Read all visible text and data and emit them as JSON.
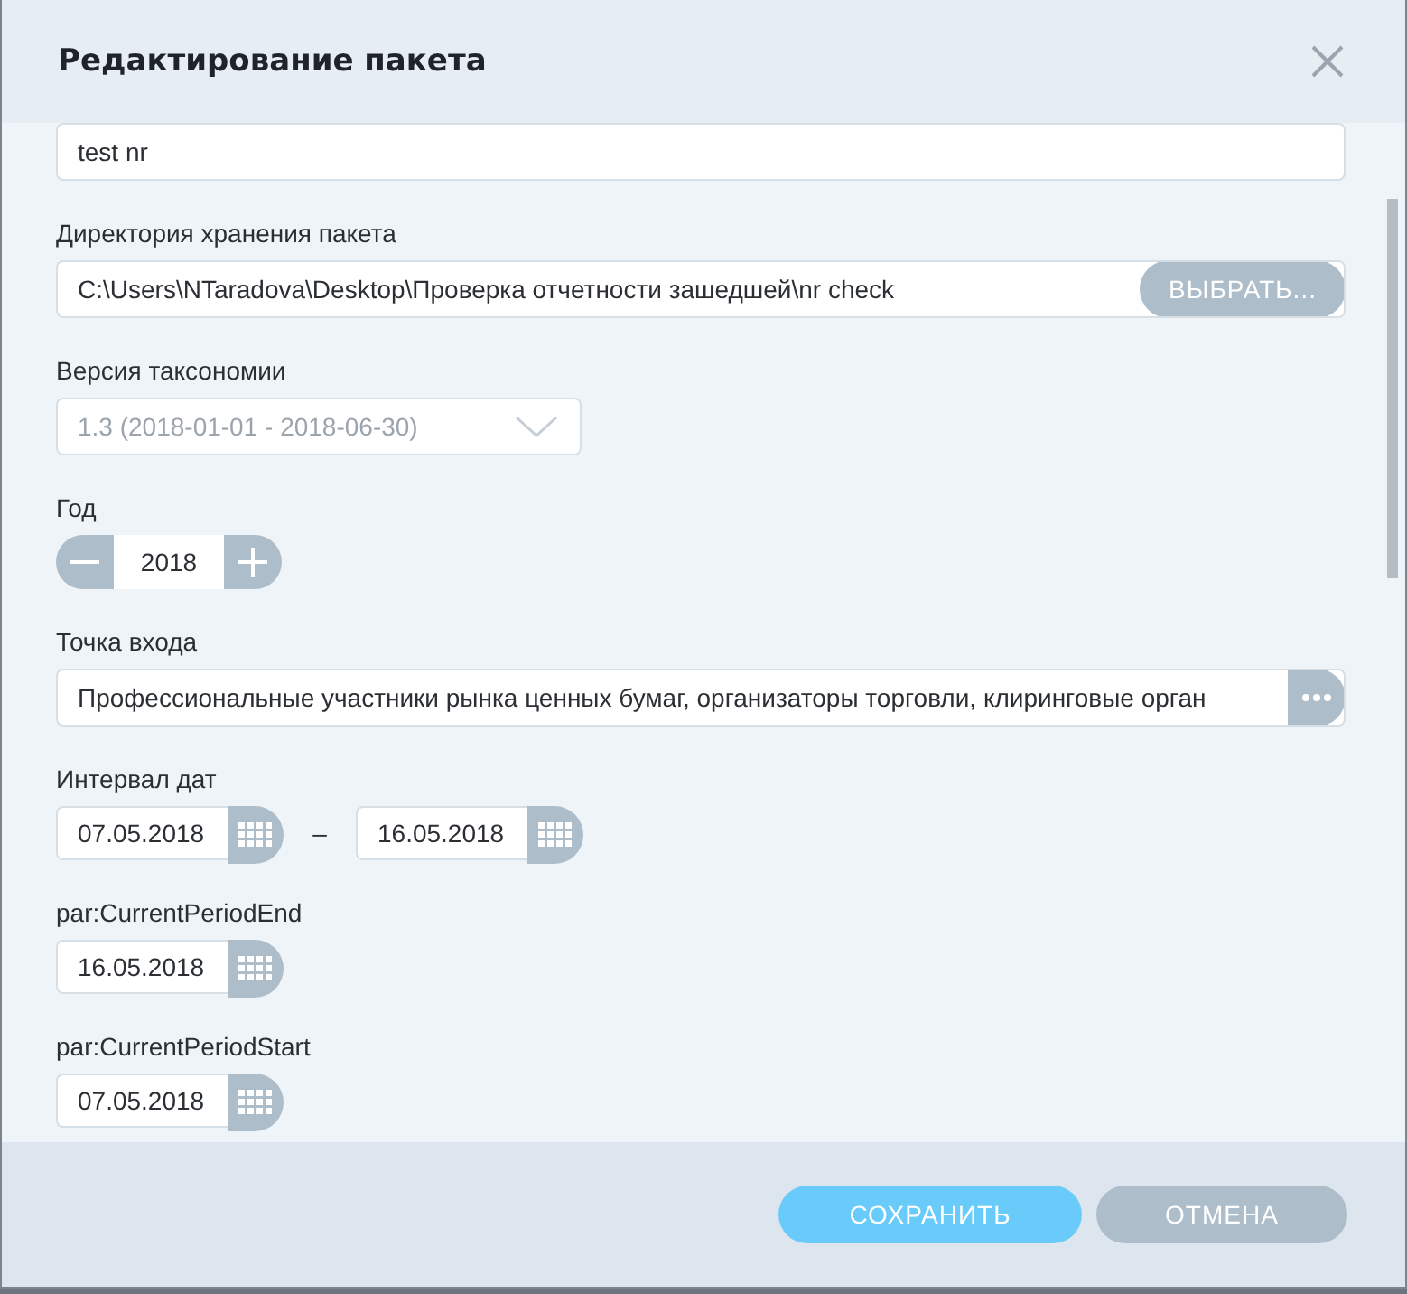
{
  "dialog": {
    "title": "Редактирование пакета"
  },
  "fields": [
    {
      "kind": "text",
      "value": "test nr"
    },
    {
      "kind": "path",
      "label": "Директория хранения пакета",
      "value": "C:\\Users\\NTaradova\\Desktop\\Проверка отчетности зашедшей\\nr check",
      "button": "ВЫБРАТЬ..."
    },
    {
      "kind": "select",
      "label": "Версия таксономии",
      "value": "1.3 (2018-01-01 - 2018-06-30)",
      "disabled": true
    },
    {
      "kind": "stepper",
      "label": "Год",
      "value": "2018"
    },
    {
      "kind": "picker",
      "label": "Точка входа",
      "value": "Профессиональные участники рынка ценных бумаг, организаторы торговли, клиринговые орган"
    },
    {
      "kind": "daterange",
      "label": "Интервал дат",
      "from": "07.05.2018",
      "separator": "–",
      "to": "16.05.2018"
    },
    {
      "kind": "date",
      "label": "par:CurrentPeriodEnd",
      "value": "16.05.2018"
    },
    {
      "kind": "date",
      "label": "par:CurrentPeriodStart",
      "value": "07.05.2018"
    }
  ],
  "buttons": [
    {
      "label": "СОХРАНИТЬ",
      "primary": true
    },
    {
      "label": "ОТМЕНА",
      "primary": false
    }
  ]
}
